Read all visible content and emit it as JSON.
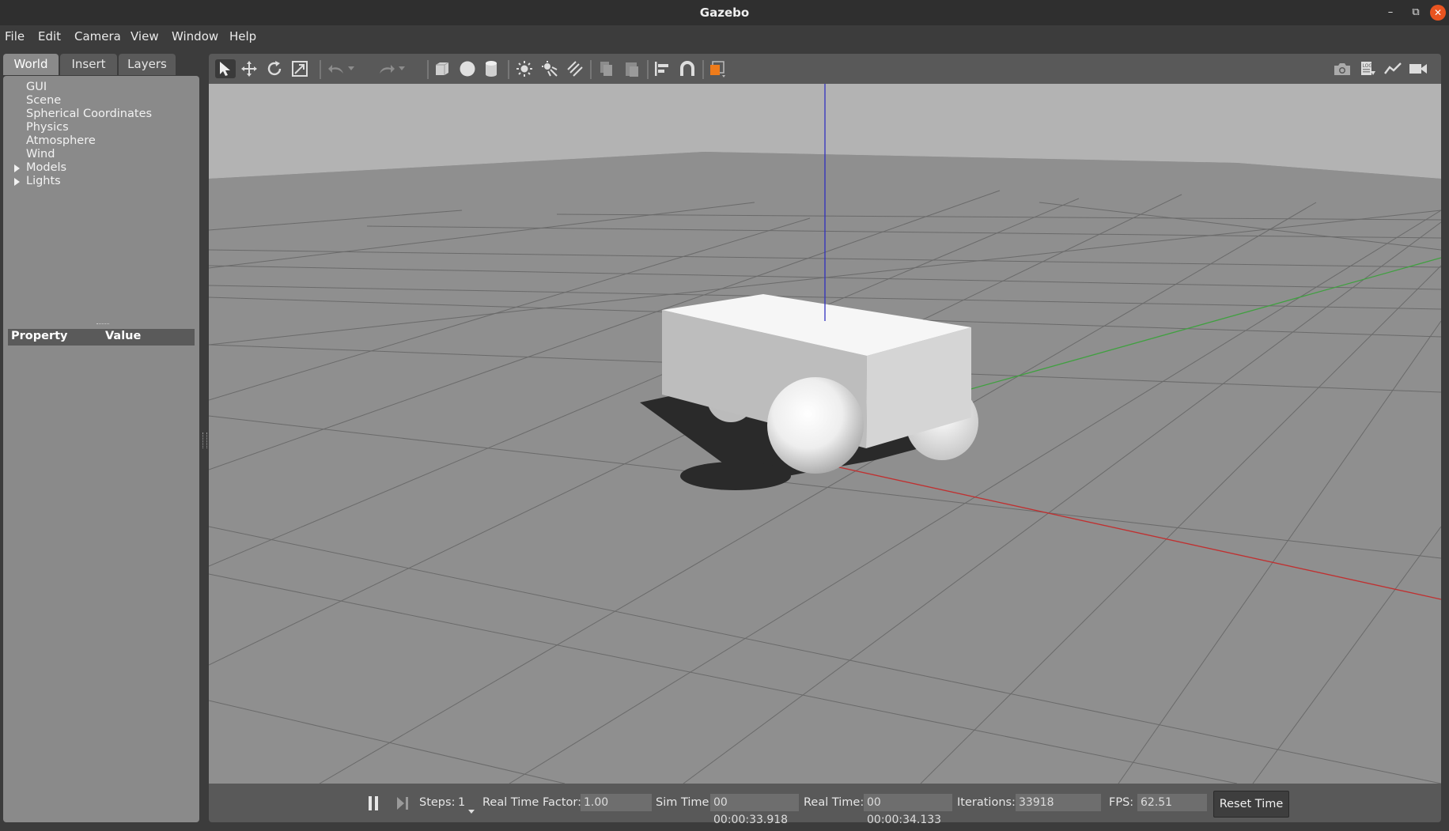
{
  "window": {
    "title": "Gazebo"
  },
  "menu": [
    "File",
    "Edit",
    "Camera",
    "View",
    "Window",
    "Help"
  ],
  "left_tabs": [
    "World",
    "Insert",
    "Layers"
  ],
  "world_tree": [
    {
      "label": "GUI",
      "expandable": false
    },
    {
      "label": "Scene",
      "expandable": false
    },
    {
      "label": "Spherical Coordinates",
      "expandable": false
    },
    {
      "label": "Physics",
      "expandable": false
    },
    {
      "label": "Atmosphere",
      "expandable": false
    },
    {
      "label": "Wind",
      "expandable": false
    },
    {
      "label": "Models",
      "expandable": true
    },
    {
      "label": "Lights",
      "expandable": true
    }
  ],
  "property_table": {
    "col1": "Property",
    "col2": "Value"
  },
  "toolbar": {
    "left": [
      "select-mode-icon",
      "translate-mode-icon",
      "rotate-mode-icon",
      "scale-mode-icon",
      "undo-icon",
      "undo-history-icon",
      "redo-icon",
      "redo-history-icon",
      "box-shape-icon",
      "sphere-shape-icon",
      "cylinder-shape-icon",
      "point-light-icon",
      "spot-light-icon",
      "directional-light-icon",
      "copy-icon",
      "paste-icon",
      "align-icon",
      "snap-icon",
      "view-angle-icon"
    ],
    "right": [
      "screenshot-icon",
      "log-icon",
      "plot-icon",
      "video-record-icon"
    ],
    "accent": "#f07c1b"
  },
  "bottom": {
    "steps_label": "Steps:",
    "steps_value": "1",
    "rtf_label": "Real Time Factor:",
    "rtf_value": "1.00",
    "sim_label": "Sim Time:",
    "sim_value": "00 00:00:33.918",
    "real_label": "Real Time:",
    "real_value": "00 00:00:34.133",
    "iter_label": "Iterations:",
    "iter_value": "33918",
    "fps_label": "FPS:",
    "fps_value": "62.51",
    "reset_label": "Reset Time"
  },
  "colors": {
    "close_button": "#e95420",
    "axis_x": "#c03030",
    "axis_y": "#40a040",
    "axis_z": "#3030c0"
  }
}
